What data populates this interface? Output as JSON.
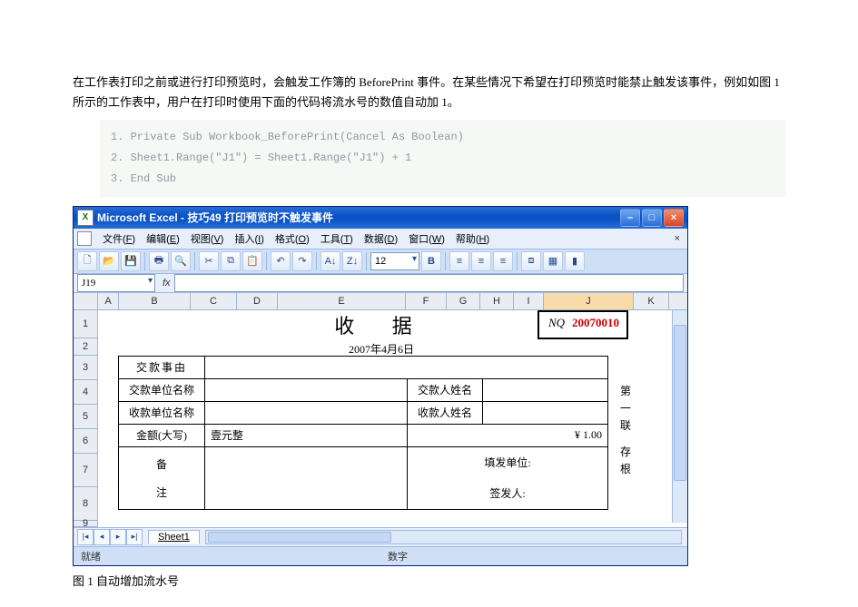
{
  "para1": "在工作表打印之前或进行打印预览时，会触发工作簿的 BeforePrint 事件。在某些情况下希望在打印预览时能禁止触发该事件，例如如图 1 所示的工作表中，用户在打印时使用下面的代码将流水号的数值自动加 1。",
  "code": {
    "l1": "1.  Private Sub Workbook_BeforePrint(Cancel As Boolean)",
    "l2": "2.      Sheet1.Range(\"J1\") = Sheet1.Range(\"J1\") + 1",
    "l3": "3.  End Sub"
  },
  "window": {
    "app_icon": "X",
    "title": "Microsoft Excel - 技巧49 打印预览时不触发事件",
    "min": "–",
    "max": "□",
    "close": "×"
  },
  "menus": {
    "file": {
      "t": "文件",
      "k": "F"
    },
    "edit": {
      "t": "编辑",
      "k": "E"
    },
    "view": {
      "t": "视图",
      "k": "V"
    },
    "insert": {
      "t": "插入",
      "k": "I"
    },
    "format": {
      "t": "格式",
      "k": "O"
    },
    "tools": {
      "t": "工具",
      "k": "T"
    },
    "data": {
      "t": "数据",
      "k": "D"
    },
    "window": {
      "t": "窗口",
      "k": "W"
    },
    "help": {
      "t": "帮助",
      "k": "H"
    },
    "close_x": "×"
  },
  "toolbar": {
    "font_size": "12",
    "bold": "B"
  },
  "formula": {
    "namebox": "J19",
    "fx": "fx"
  },
  "columns": [
    "A",
    "B",
    "C",
    "D",
    "E",
    "F",
    "G",
    "H",
    "I",
    "J",
    "K"
  ],
  "rows": [
    "1",
    "2",
    "3",
    "4",
    "5",
    "6",
    "7",
    "8",
    "9"
  ],
  "receipt": {
    "title": "收  据",
    "date": "2007年4月6日",
    "nq_label": "NQ",
    "nq_value": "20070010",
    "r3": "交款事由",
    "r4a": "交款单位名称",
    "r4b": "交款人姓名",
    "r5a": "收款单位名称",
    "r5b": "收款人姓名",
    "r6a": "金额(大写)",
    "r6b": "壹元整",
    "r6c": "¥ 1.00",
    "r78a": "备",
    "r78b": "注",
    "r7": "填发单位:",
    "r8": "签发人:",
    "side1": "第",
    "side2": "一",
    "side3": "联",
    "side4": "存",
    "side5": "根"
  },
  "tabs": {
    "sheet1": "Sheet1",
    "nav_first": "|◂",
    "nav_prev": "◂",
    "nav_next": "▸",
    "nav_last": "▸|"
  },
  "status": {
    "left": "就绪",
    "mid": "数字"
  },
  "caption": "图 1 自动增加流水号"
}
